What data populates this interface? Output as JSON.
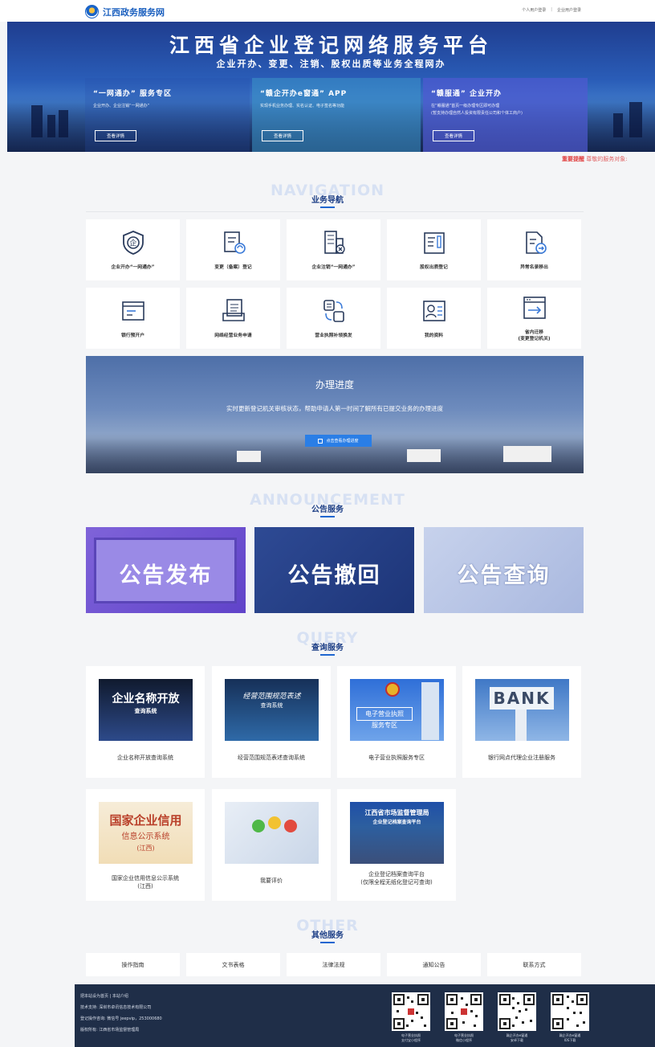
{
  "header": {
    "site_name": "江西政务服务网",
    "links": [
      "个人用户登录",
      "企业用户登录"
    ],
    "sep": "|"
  },
  "banner": {
    "title": "江西省企业登记网络服务平台",
    "subtitle": "企业开办、变更、注销、股权出质等业务全程网办",
    "cards": [
      {
        "title": "“一网通办” 服务专区",
        "desc": [
          "企业开办、企业注销“一网通办”"
        ],
        "button": "查看详情"
      },
      {
        "title": "“赣企开办e窗通” APP",
        "desc": [
          "实现手机业务办理、实名认证、电子签名等功能"
        ],
        "button": "查看详情"
      },
      {
        "title": "“赣服通” 企业开办",
        "desc": [
          "在“赣服通”首页一级办理专区即可办理",
          "(暂支持办理自然人投资有限责任公司和个体工商户)"
        ],
        "button": "查看详情"
      }
    ]
  },
  "notice": {
    "tag": "重要提醒",
    "text": " 尊敬的服务对象:"
  },
  "navigation": {
    "en": "NAVIGATION",
    "title": "业务导航",
    "items": [
      {
        "label": "企业开办“一网通办”",
        "icon": "shield-enterprise-icon"
      },
      {
        "label": "变更（备案）登记",
        "icon": "document-refresh-icon"
      },
      {
        "label": "企业注销“一网通办”",
        "icon": "building-cancel-icon"
      },
      {
        "label": "股权出质登记",
        "icon": "document-pen-icon"
      },
      {
        "label": "异常名录移出",
        "icon": "document-arrow-icon"
      },
      {
        "label": "银行预开户",
        "icon": "bank-card-icon"
      },
      {
        "label": "网络经营业务申请",
        "icon": "stacked-document-icon"
      },
      {
        "label": "营业执照补领换发",
        "icon": "exchange-license-icon"
      },
      {
        "label": "我的资料",
        "icon": "profile-card-icon"
      },
      {
        "label": "省内迁移\n(变更登记机关)",
        "icon": "browser-transfer-icon"
      }
    ]
  },
  "progress": {
    "title": "办理进度",
    "desc": "实时更新登记机关审核状态，帮助申请人第一时间了解所有已提交业务的办理进度",
    "button": "点击查看办理进度"
  },
  "announcement": {
    "en": "ANNOUNCEMENT",
    "title": "公告服务",
    "items": [
      "公告发布",
      "公告撤回",
      "公告查询"
    ]
  },
  "query": {
    "en": "QUERY",
    "title": "查询服务",
    "items": [
      {
        "label": "企业名称开放查询系统",
        "img_title": "企业名称开放",
        "img_sub": "查询系统"
      },
      {
        "label": "经营范围规范表述查询系统",
        "img_title": "经营范围规范表述",
        "img_sub": "查询系统"
      },
      {
        "label": "电子营业执照服务专区",
        "img_title": "电子营业执照",
        "img_sub": "服务专区"
      },
      {
        "label": "银行网点代理企业注册服务",
        "img_title": "BANK",
        "img_sub": ""
      },
      {
        "label": "国家企业信用信息公示系统\n(江西)",
        "img_title": "国家企业信用",
        "img_sub": "信息公示系统",
        "img_sub2": "(江西)"
      },
      {
        "label": "我要评价",
        "img_title": "",
        "img_sub": ""
      },
      {
        "label": "企业登记档案查询平台\n(仅限全程无纸化登记可查询)",
        "img_title": "江西省市场监督管理局",
        "img_sub": "企业登记档案查询平台"
      }
    ]
  },
  "other": {
    "en": "OTHER",
    "title": "其他服务",
    "items": [
      "操作指南",
      "文书表格",
      "法律法规",
      "通知公告",
      "联系方式"
    ]
  },
  "footer": {
    "lines": [
      "把本站设为首页 | 本站介绍",
      "技术支持: 深圳市卓讯信息技术有限公司",
      "登记操作咨询: 微信号 jeepvip，253000680",
      "版权所有: 江西省市场监督管理局"
    ],
    "qrcodes": [
      {
        "caption": "电子营业执照\n支付宝小程序"
      },
      {
        "caption": "电子营业执照\n微信小程序"
      },
      {
        "caption": "赣企开办e窗通\n安卓下载"
      },
      {
        "caption": "赣企开办e窗通\nIOS下载"
      }
    ]
  },
  "colors": {
    "brand": "#1a5fbf",
    "accent": "#1e66d0",
    "alert": "#e04040",
    "footer_bg": "#1f2e48"
  }
}
